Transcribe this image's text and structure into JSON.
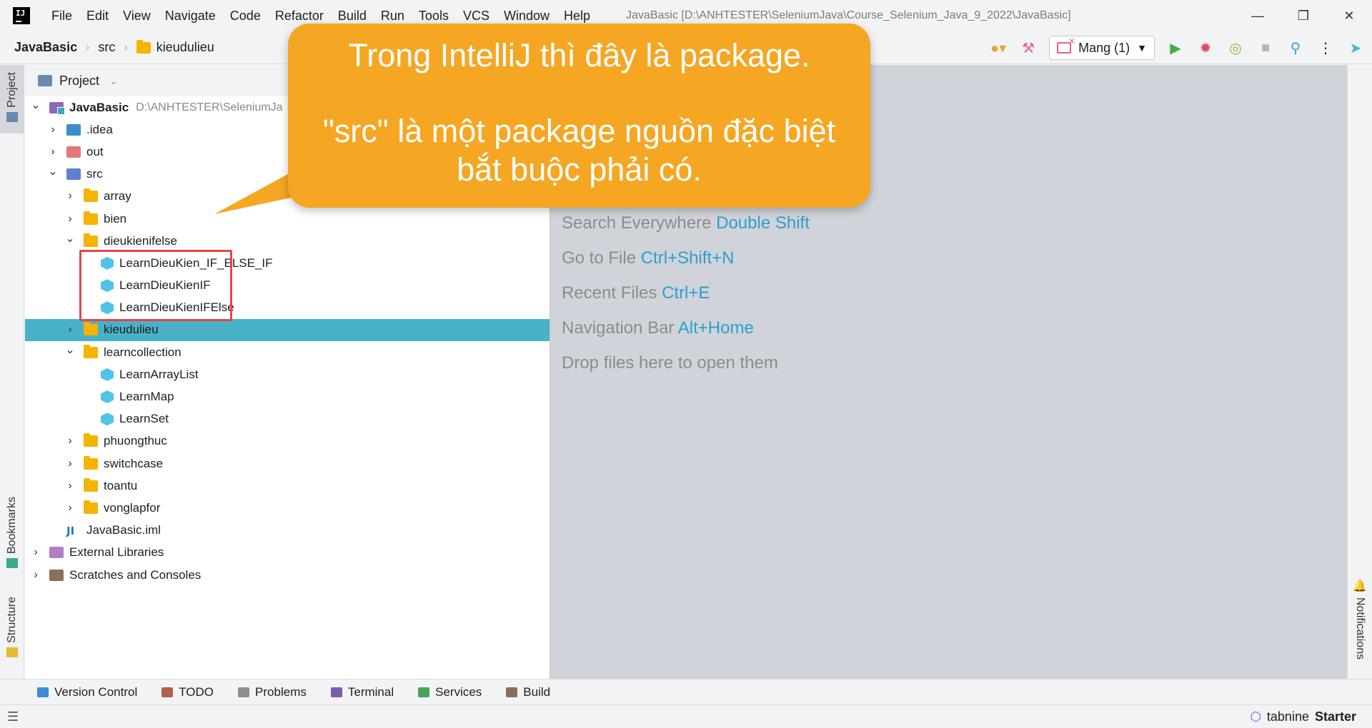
{
  "menu": [
    "File",
    "Edit",
    "View",
    "Navigate",
    "Code",
    "Refactor",
    "Build",
    "Run",
    "Tools",
    "VCS",
    "Window",
    "Help"
  ],
  "window_title": "JavaBasic [D:\\ANHTESTER\\SeleniumJava\\Course_Selenium_Java_9_2022\\JavaBasic]",
  "breadcrumb": {
    "project": "JavaBasic",
    "src": "src",
    "folder": "kieudulieu"
  },
  "run_config": "Mang (1)",
  "project_panel": {
    "title": "Project",
    "root_name": "JavaBasic",
    "root_path": "D:\\ANHTESTER\\SeleniumJa"
  },
  "tree": [
    {
      "label": "JavaBasic",
      "depth": 0,
      "expanded": true,
      "icon": "module-icon"
    },
    {
      "label": ".idea",
      "depth": 1,
      "expanded": false,
      "icon": "idea-folder-icon"
    },
    {
      "label": "out",
      "depth": 1,
      "expanded": false,
      "icon": "out-folder-icon"
    },
    {
      "label": "src",
      "depth": 1,
      "expanded": true,
      "icon": "source-folder-icon"
    },
    {
      "label": "array",
      "depth": 2,
      "expanded": false,
      "icon": "package-icon"
    },
    {
      "label": "bien",
      "depth": 2,
      "expanded": false,
      "icon": "package-icon"
    },
    {
      "label": "dieukienifelse",
      "depth": 2,
      "expanded": true,
      "icon": "package-icon"
    },
    {
      "label": "LearnDieuKien_IF_ELSE_IF",
      "depth": 3,
      "leaf": true,
      "icon": "java-class-icon"
    },
    {
      "label": "LearnDieuKienIF",
      "depth": 3,
      "leaf": true,
      "icon": "java-class-icon"
    },
    {
      "label": "LearnDieuKienIFElse",
      "depth": 3,
      "leaf": true,
      "icon": "java-class-icon"
    },
    {
      "label": "kieudulieu",
      "depth": 2,
      "expanded": false,
      "icon": "package-icon",
      "selected": true
    },
    {
      "label": "learncollection",
      "depth": 2,
      "expanded": true,
      "icon": "package-icon"
    },
    {
      "label": "LearnArrayList",
      "depth": 3,
      "leaf": true,
      "icon": "java-class-icon"
    },
    {
      "label": "LearnMap",
      "depth": 3,
      "leaf": true,
      "icon": "java-class-icon"
    },
    {
      "label": "LearnSet",
      "depth": 3,
      "leaf": true,
      "icon": "java-class-icon"
    },
    {
      "label": "phuongthuc",
      "depth": 2,
      "expanded": false,
      "icon": "package-icon"
    },
    {
      "label": "switchcase",
      "depth": 2,
      "expanded": false,
      "icon": "package-icon"
    },
    {
      "label": "toantu",
      "depth": 2,
      "expanded": false,
      "icon": "package-icon"
    },
    {
      "label": "vonglapfor",
      "depth": 2,
      "expanded": false,
      "icon": "package-icon"
    },
    {
      "label": "JavaBasic.iml",
      "depth": 1,
      "leaf": true,
      "icon": "iml-file-icon"
    },
    {
      "label": "External Libraries",
      "depth": 0,
      "expanded": false,
      "icon": "library-icon"
    },
    {
      "label": "Scratches and Consoles",
      "depth": 0,
      "expanded": false,
      "icon": "scratch-icon"
    }
  ],
  "editor_hints": [
    {
      "text": "Search Everywhere",
      "key": "Double Shift"
    },
    {
      "text": "Go to File",
      "key": "Ctrl+Shift+N"
    },
    {
      "text": "Recent Files",
      "key": "Ctrl+E"
    },
    {
      "text": "Navigation Bar",
      "key": "Alt+Home"
    },
    {
      "text": "Drop files here to open them",
      "key": ""
    }
  ],
  "left_tabs": {
    "project": "Project",
    "bookmarks": "Bookmarks",
    "structure": "Structure"
  },
  "right_tabs": {
    "notifications": "Notifications"
  },
  "bottom_tools": [
    "Version Control",
    "TODO",
    "Problems",
    "Terminal",
    "Services",
    "Build"
  ],
  "status": {
    "tabnine": "tabnine",
    "tabnine_plan": "Starter"
  },
  "callout": {
    "line1": "Trong IntelliJ thì đây là package.",
    "line2": "\"src\" là một package nguồn đặc biệt",
    "line3": "bắt buộc phải có."
  },
  "colors": {
    "selection": "#4ab2c8",
    "callout": "#f5a623",
    "highlight": "#e0484a",
    "key": "#2d9ed0"
  }
}
